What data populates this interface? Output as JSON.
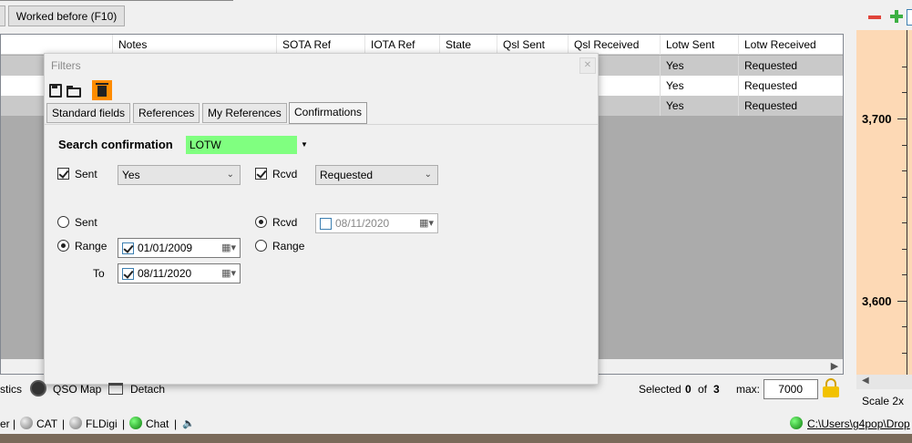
{
  "toolbar": {
    "worked_before_label": "Worked before (F10)"
  },
  "grid": {
    "columns": [
      "Notes",
      "SOTA Ref",
      "IOTA Ref",
      "State",
      "Qsl Sent",
      "Qsl Received",
      "Lotw Sent",
      "Lotw Received"
    ],
    "rows": [
      {
        "lotw_sent": "Yes",
        "lotw_received": "Requested"
      },
      {
        "lotw_sent": "Yes",
        "lotw_received": "Requested"
      },
      {
        "lotw_sent": "Yes",
        "lotw_received": "Requested"
      }
    ]
  },
  "right_panel": {
    "labels": [
      "3,700",
      "3,600"
    ],
    "scale_label": "Scale 2x"
  },
  "dialog": {
    "title": "Filters",
    "tabs": [
      "Standard fields",
      "References",
      "My References",
      "Confirmations"
    ],
    "search_confirmation_label": "Search confirmation",
    "search_confirmation_value": "LOTW",
    "sent_label": "Sent",
    "sent_value": "Yes",
    "rcvd_label": "Rcvd",
    "rcvd_value": "Requested",
    "sent_radio_label": "Sent",
    "range_radio_label": "Range",
    "to_label": "To",
    "range_from_date": "01/01/2009",
    "range_to_date": "08/11/2020",
    "rcvd_radio_label": "Rcvd",
    "rcvd_date": "08/11/2020",
    "rcvd_range_label": "Range"
  },
  "bottom_bar": {
    "statistics_label": "stics",
    "qso_map_label": "QSO Map",
    "detach_label": "Detach",
    "selected_label": "Selected",
    "selected_count": "0",
    "of_label": "of",
    "total_count": "3",
    "max_label": "max:",
    "max_value": "7000"
  },
  "status_bar": {
    "item_partial": "er",
    "cat_label": "CAT",
    "fldigi_label": "FLDigi",
    "chat_label": "Chat",
    "path": "C:\\Users\\g4pop\\Drop"
  },
  "colors": {
    "accent_green": "#80ff80",
    "trash_orange": "#ff8c00",
    "panel_peach": "#fdd9b5"
  }
}
